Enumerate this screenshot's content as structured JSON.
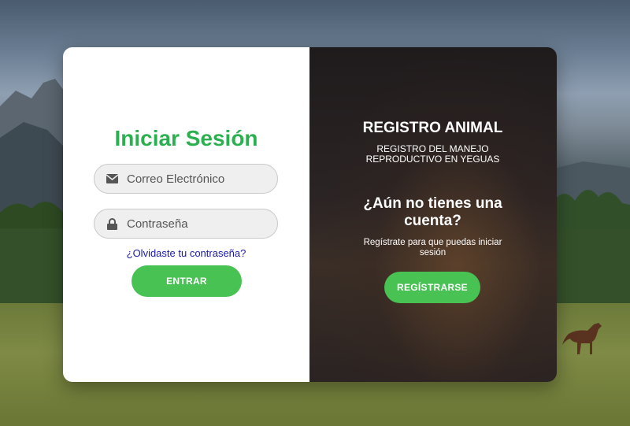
{
  "login": {
    "title": "Iniciar Sesión",
    "email_placeholder": "Correo Electrónico",
    "password_placeholder": "Contraseña",
    "forgot_link": "¿Olvidaste tu contraseña?",
    "submit_label": "ENTRAR"
  },
  "promo": {
    "title": "REGISTRO ANIMAL",
    "subtitle": "REGISTRO DEL MANEJO REPRODUCTIVO EN YEGUAS",
    "question": "¿Aún no tienes una cuenta?",
    "hint": "Regístrate para que puedas iniciar sesión",
    "register_label": "REGÍSTRARSE"
  },
  "colors": {
    "accent_green": "#47c253",
    "title_green": "#2bb04f",
    "link_blue": "#1a1aa8"
  },
  "icons": {
    "email": "envelope-icon",
    "password": "lock-icon"
  }
}
